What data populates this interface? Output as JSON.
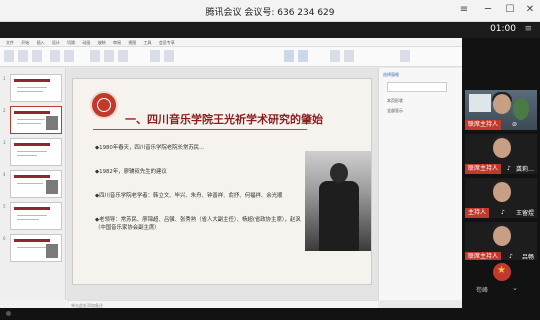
{
  "window": {
    "title": "腾讯会议 会议号: 636 234 629",
    "timer": "01:00"
  },
  "ppt": {
    "menu": [
      "文件",
      "开始",
      "插入",
      "设计",
      "切换",
      "动画",
      "放映",
      "审阅",
      "视图",
      "工具",
      "会员专享"
    ],
    "slide_title": "一、四川音乐学院王光祈学术研究的肇始",
    "bullets": [
      "◆1980年春天，四川音乐学院老院长常苏民…",
      "◆1982年，廖辅叔先生的建议",
      "◆四川音乐学院老学者：韩立文、毕兴、朱舟、钟善祥、俞抒、何福祥、余光顺",
      "◆老领导：常苏民、廖锦超、吕骥、张秀熟（省人大副主任）、杨超(省政协主席），赵沨（中国音乐家协会副主席）"
    ],
    "notes_placeholder": "单击此处添加备注",
    "slide_numbers": [
      "1",
      "2",
      "3",
      "4",
      "5",
      "6"
    ],
    "taskpane": {
      "header": "选择窗格",
      "rows": [
        "本页形状",
        "全部显示"
      ]
    }
  },
  "participants": [
    {
      "tag": "联席主持人",
      "name": "",
      "mic": "muted"
    },
    {
      "tag": "联席主持人",
      "name": "龚莉…",
      "mic": "on"
    },
    {
      "tag": "主持人",
      "name": "王留煜",
      "mic": "on"
    },
    {
      "tag": "联席主持人",
      "name": "吕畅",
      "mic": "on"
    },
    {
      "tag": "",
      "name": "",
      "mic": ""
    }
  ],
  "bottom_user": "苟峰",
  "colors": {
    "accent": "#c0392b",
    "title_red": "#8b1d1d"
  }
}
